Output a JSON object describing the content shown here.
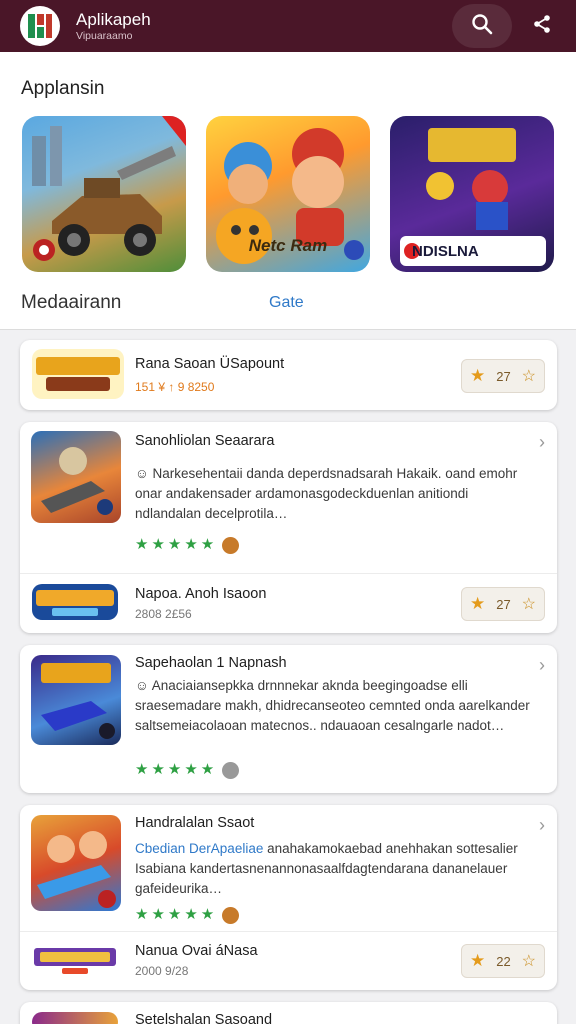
{
  "appbar": {
    "title": "Aplikapeh",
    "subtitle": "Vipuaraamo",
    "bg_color": "#4a1628"
  },
  "featured": {
    "title": "Applansin",
    "tiles": [
      {
        "caption": "",
        "icon": "off-road-car-game-icon"
      },
      {
        "caption": "Netc Ram",
        "icon": "cartoon-heroes-game-icon"
      },
      {
        "caption": "NDISLNA",
        "icon": "dodainar-game-icon"
      }
    ],
    "subtitle": "Medaairann",
    "link": "Gate"
  },
  "list": [
    {
      "title": "Rana Saoan ÜSapount",
      "meta": "151 ¥ ↑ 9 8250",
      "rating": "27",
      "logo": "ilasdan-logo"
    },
    {
      "title": "Sanohliolan Seaarara",
      "description": "☺ Narkesehentaii danda deperdsnadsarah Hakaik. oand emohr onar andakensader ardamonasgodeckduenlan anitiondi ndlandalan decelprotila…",
      "stars": "★★★★★"
    },
    {
      "title": "Napoa. Anoh Isaoon",
      "meta": "2808 2£56",
      "rating": "27",
      "logo": "nunaarin-logo"
    },
    {
      "title": "Sapehaolan 1 Napnash",
      "description": "☺ Anaciaiansepkka drnnnekar aknda beegingoadse elli sraesemadare makh, dhidrecanseoteo cemnted onda aarelkander saltsemeiacolaoan matecnos.. ndauaoan cesalngarle nadot…",
      "stars": "★★★★★"
    },
    {
      "title": "Handralalan Ssaot",
      "desc_link": "Cbedian DerApaeliae",
      "description": "anahakamokaebad anehhakan sottesalier Isabiana kandertasnenannonasaalfdagtendarana dananelauer gafeideurika…",
      "stars": "★★★★★"
    },
    {
      "title": "Nanua Ovai áNasa",
      "meta": "2000 9/28",
      "rating": "22",
      "logo": "nudadaar-logo"
    },
    {
      "title": "Setelshalan Sasoand"
    }
  ]
}
